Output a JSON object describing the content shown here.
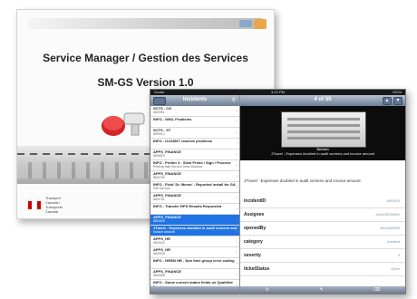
{
  "slide": {
    "title": "Service Manager / Gestion des Services",
    "subtitle": "SM-GS Version 1.0",
    "footer_org": "Transport Canada / Transports Canada"
  },
  "ipad": {
    "status": {
      "carrier": "Scotia",
      "time": "3:22 PM",
      "battery": "100%"
    },
    "master": {
      "title": "Incidents",
      "rows": [
        {
          "line1": "SCTS - CG",
          "line2": "I800951"
        },
        {
          "line1": "INFO - WISL Problems",
          "line2": ""
        },
        {
          "line1": "SCTS - ST",
          "line2": "I800912"
        },
        {
          "line1": "INFO - I1234567 reactive problems",
          "line2": ""
        },
        {
          "line1": "APPS_FINANCE",
          "line2": "I800823"
        },
        {
          "line1": "INFO - Printer 3 - Slow Prints / Sign / Process",
          "line2": "Printing fails Service Desk Modular"
        },
        {
          "line1": "APPS_FINANCE",
          "line2": "I800760"
        },
        {
          "line1": "INFO - Field 'Dr. Memo' - Reported install for GA",
          "line2": "Self Service"
        },
        {
          "line1": "APPS_FINANCE",
          "line2": "I800751"
        },
        {
          "line1": "INFO - Transfer RPS Results Requested",
          "line2": ""
        },
        {
          "line1": "APPS_FINANCE",
          "line2": "I800403",
          "selected": true
        },
        {
          "line1": "JTravel - Expenses doubled in audit screens and",
          "line2": "invoice amount",
          "selected": true
        },
        {
          "line1": "APPS_HR",
          "line2": "I800342"
        },
        {
          "line1": "APPS_HR",
          "line2": "I800339"
        },
        {
          "line1": "INFO - HRSM HR - Non time group error coding",
          "line2": ""
        },
        {
          "line1": "APPS_FINANCE",
          "line2": "I800308"
        },
        {
          "line1": "INFO - Some current status fields on Qualified Prod",
          "line2": "with 2 different Risk Amount"
        },
        {
          "line1": "APPS_HR",
          "line2": "I800806"
        }
      ]
    },
    "detail": {
      "title": "4 of 55",
      "caption_title": "Screen",
      "caption": "JTravel - Expenses doubled in audit screens and invoice amount",
      "summary": "JTravel - Expenses doubled in audit screens and invoice amount",
      "fields": [
        {
          "key": "incidentID",
          "value": "I800403"
        },
        {
          "key": "Assignee",
          "value": "UNASSIGNED"
        },
        {
          "key": "openedBy",
          "value": "BALANDER"
        },
        {
          "key": "category",
          "value": "incident"
        },
        {
          "key": "severity",
          "value": "3"
        },
        {
          "key": "ticketStatus",
          "value": "Open"
        }
      ]
    }
  }
}
